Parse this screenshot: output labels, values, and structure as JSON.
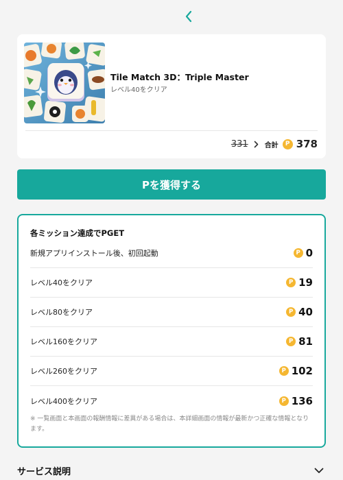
{
  "header": {
    "back_icon": "chevron-left-icon",
    "accent_color": "#17a89c"
  },
  "app_card": {
    "title": "Tile Match 3D：Triple Master",
    "subtitle": "レベル40をクリア",
    "old_points": "331",
    "total_label": "合計",
    "coin_symbol": "P",
    "total_points": "378"
  },
  "cta": {
    "label": "Pを獲得する",
    "color": "#17a89c"
  },
  "missions": {
    "heading": "各ミッション達成でPGET",
    "items": [
      {
        "label": "新規アプリインストール後、初回起動",
        "points": "0"
      },
      {
        "label": "レベル40をクリア",
        "points": "19"
      },
      {
        "label": "レベル80をクリア",
        "points": "40"
      },
      {
        "label": "レベル160をクリア",
        "points": "81"
      },
      {
        "label": "レベル260をクリア",
        "points": "102"
      },
      {
        "label": "レベル400をクリア",
        "points": "136"
      }
    ],
    "note": "※ 一覧画面と本画面の報酬情報に差異がある場合は、本詳細画面の情報が最新かつ正確な情報となります。"
  },
  "service": {
    "title": "サービス説明",
    "expand_icon": "chevron-down-icon"
  }
}
